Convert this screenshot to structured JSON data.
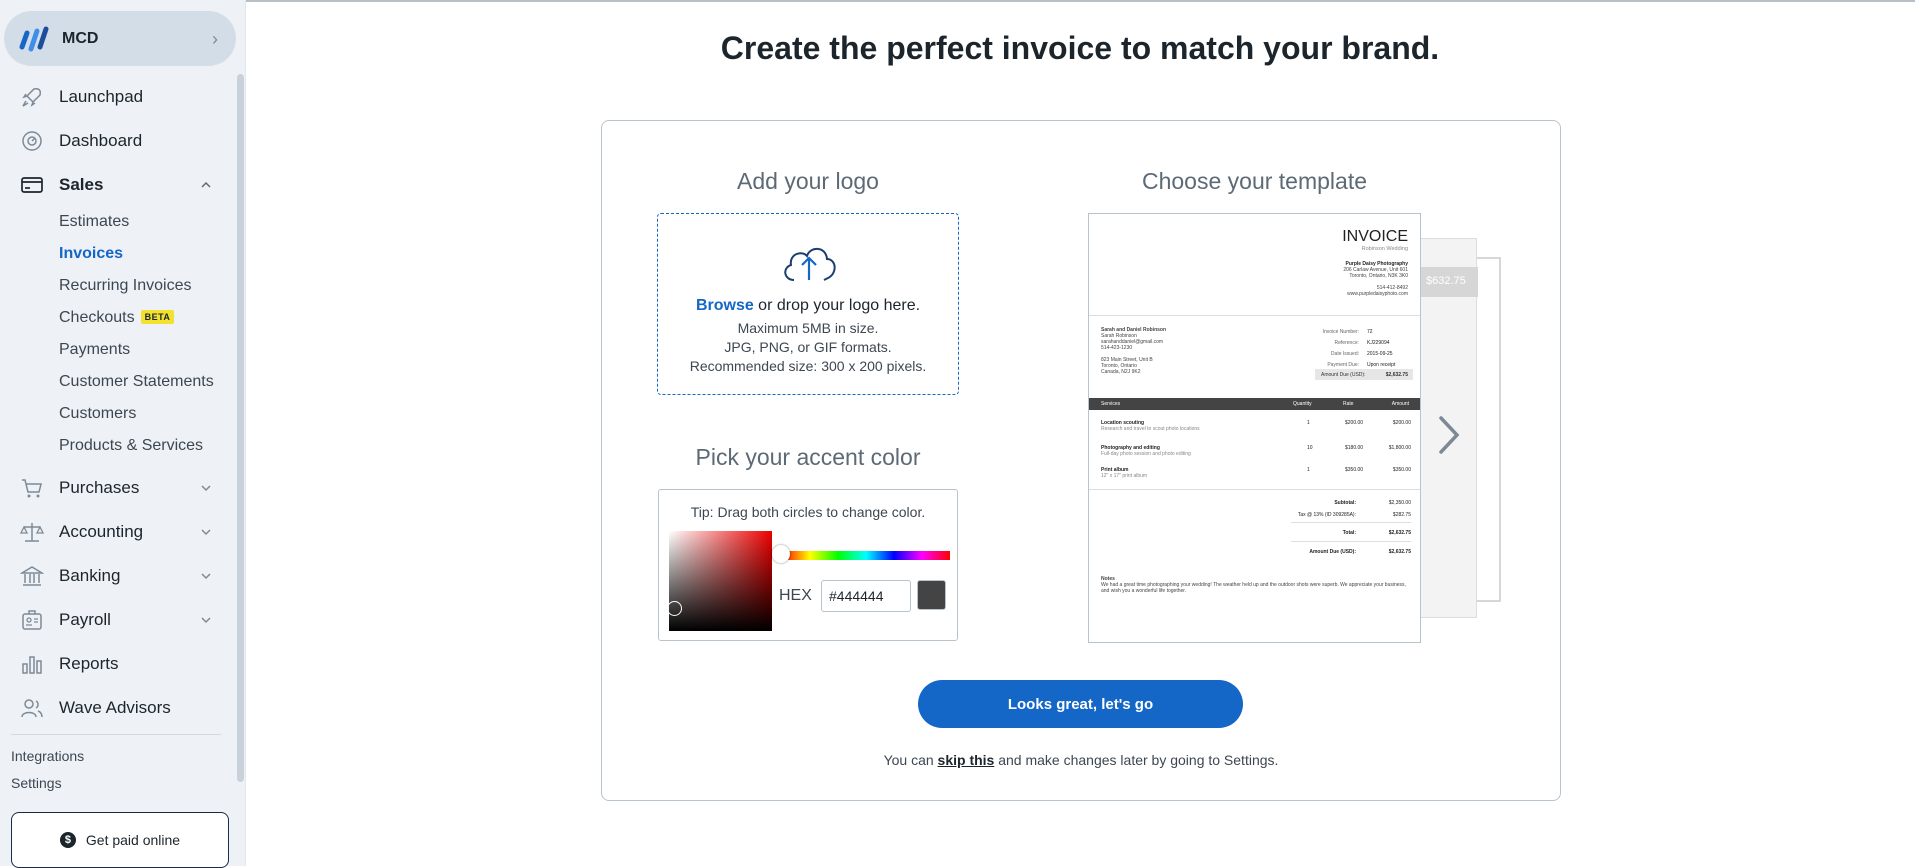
{
  "business": {
    "name": "MCD"
  },
  "nav": {
    "launchpad": "Launchpad",
    "dashboard": "Dashboard",
    "sales": "Sales",
    "sales_items": [
      "Estimates",
      "Invoices",
      "Recurring Invoices",
      "Checkouts",
      "Payments",
      "Customer Statements",
      "Customers",
      "Products & Services"
    ],
    "beta_badge": "BETA",
    "purchases": "Purchases",
    "accounting": "Accounting",
    "banking": "Banking",
    "payroll": "Payroll",
    "reports": "Reports",
    "wave_advisors": "Wave Advisors",
    "integrations": "Integrations",
    "settings": "Settings",
    "get_paid": "Get paid online",
    "dollar_glyph": "$"
  },
  "main": {
    "headline": "Create the perfect invoice to match your brand.",
    "logo_title": "Add your logo",
    "browse": "Browse",
    "drop_text": " or drop your logo here.",
    "size_note": "Maximum 5MB in size.",
    "format_note": "JPG, PNG, or GIF formats.",
    "recommended": "Recommended size: 300 x 200 pixels.",
    "accent_title": "Pick your accent color",
    "tip": "Tip: Drag both circles to change color.",
    "hex_label": "HEX",
    "hex_value": "#444444",
    "template_title": "Choose your template",
    "cta": "Looks great, let's go",
    "skip_prefix": "You can ",
    "skip_link": "skip this",
    "skip_suffix": " and make changes later by going to Settings."
  },
  "invoice": {
    "title": "INVOICE",
    "subtitle": "Robinson Wedding",
    "company": "Purple Daisy Photography",
    "company_addr1": "206 Carlaw Avenue, Unit 601",
    "company_addr2": "Toronto, Ontario, N3K 3K0",
    "company_phone": "514-412-8492",
    "company_web": "www.purpledaisyphoto.com",
    "customer": "Sarah and Daniel Robinson",
    "customer_l2": "Sarah Robinson",
    "customer_l3": "sarahanddaniel@gmail.com",
    "customer_l4": "514-423-1230",
    "customer_addr1": "823 Main Street, Unit B",
    "customer_addr2": "Toronto, Ontario",
    "customer_addr3": "Canada, N2J 9K2",
    "meta": [
      {
        "k": "Invoice Number:",
        "v": "72"
      },
      {
        "k": "Reference:",
        "v": "KJ229094"
      },
      {
        "k": "Date Issued:",
        "v": "2015-09-25"
      },
      {
        "k": "Payment Due:",
        "v": "Upon receipt"
      }
    ],
    "amount_due_label": "Amount Due (USD):",
    "amount_due": "$2,632.75",
    "headers": [
      "Services",
      "Quantity",
      "Rate",
      "Amount"
    ],
    "rows": [
      {
        "desc": "Location scouting",
        "sub": "Research and travel to scout photo locations",
        "q": "1",
        "r": "$200.00",
        "a": "$200.00"
      },
      {
        "desc": "Photography and editing",
        "sub": "Full-day photo session and photo editing",
        "q": "10",
        "r": "$180.00",
        "a": "$1,800.00"
      },
      {
        "desc": "Print album",
        "sub": "12\" x 17\" print album",
        "q": "1",
        "r": "$350.00",
        "a": "$350.00"
      }
    ],
    "subtotal_label": "Subtotal:",
    "subtotal": "$2,350.00",
    "tax_label": "Tax @ 13% (ID 309285A):",
    "tax": "$282.75",
    "total_label": "Total:",
    "total": "$2,632.75",
    "due_label": "Amount Due (USD):",
    "due": "$2,632.75",
    "notes_label": "Notes",
    "notes": "We had a great time photographing your wedding! The weather held up and the outdoor shots were superb. We appreciate your business, and wish you a wonderful life together.",
    "back_amount": "$632.75"
  },
  "colors": {
    "accent": "#444444",
    "brand_blue": "#1466c7"
  }
}
